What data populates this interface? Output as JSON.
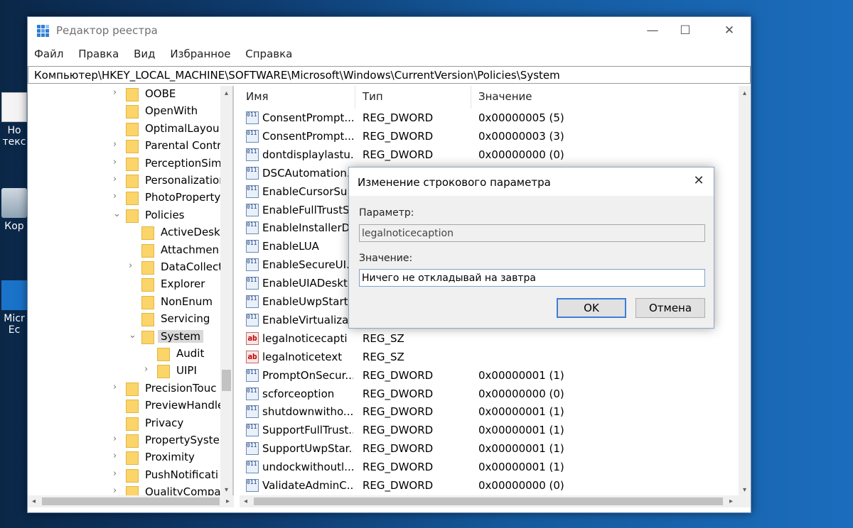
{
  "desktop": {
    "icons": [
      {
        "name": "notepad-icon",
        "label_lines": [
          "Ho",
          "текс"
        ]
      },
      {
        "name": "recycle-bin-icon",
        "label_lines": [
          "Кор"
        ]
      },
      {
        "name": "edge-icon",
        "label_lines": [
          "Micr",
          "Ec"
        ]
      }
    ]
  },
  "window": {
    "title": "Редактор реестра",
    "buttons": {
      "minimize": "—",
      "maximize": "☐",
      "close": "✕"
    },
    "menu": [
      "Файл",
      "Правка",
      "Вид",
      "Избранное",
      "Справка"
    ],
    "address": "Компьютер\\HKEY_LOCAL_MACHINE\\SOFTWARE\\Microsoft\\Windows\\CurrentVersion\\Policies\\System"
  },
  "tree": {
    "items": [
      {
        "label": "OOBE",
        "level": 0,
        "arrow": "›"
      },
      {
        "label": "OpenWith",
        "level": 0,
        "arrow": ""
      },
      {
        "label": "OptimalLayou",
        "level": 0,
        "arrow": ""
      },
      {
        "label": "Parental Contr",
        "level": 0,
        "arrow": "›"
      },
      {
        "label": "PerceptionSim",
        "level": 0,
        "arrow": "›"
      },
      {
        "label": "Personalization",
        "level": 0,
        "arrow": "›"
      },
      {
        "label": "PhotoProperty",
        "level": 0,
        "arrow": "›"
      },
      {
        "label": "Policies",
        "level": 0,
        "arrow": "⌄"
      },
      {
        "label": "ActiveDeskt",
        "level": 1,
        "arrow": ""
      },
      {
        "label": "Attachmen",
        "level": 1,
        "arrow": ""
      },
      {
        "label": "DataCollect",
        "level": 1,
        "arrow": "›"
      },
      {
        "label": "Explorer",
        "level": 1,
        "arrow": ""
      },
      {
        "label": "NonEnum",
        "level": 1,
        "arrow": ""
      },
      {
        "label": "Servicing",
        "level": 1,
        "arrow": ""
      },
      {
        "label": "System",
        "level": 1,
        "arrow": "⌄",
        "selected": true
      },
      {
        "label": "Audit",
        "level": 2,
        "arrow": ""
      },
      {
        "label": "UIPI",
        "level": 2,
        "arrow": "›"
      },
      {
        "label": "PrecisionTouc",
        "level": 0,
        "arrow": "›"
      },
      {
        "label": "PreviewHandle",
        "level": 0,
        "arrow": ""
      },
      {
        "label": "Privacy",
        "level": 0,
        "arrow": ""
      },
      {
        "label": "PropertySyster",
        "level": 0,
        "arrow": "›"
      },
      {
        "label": "Proximity",
        "level": 0,
        "arrow": "›"
      },
      {
        "label": "PushNotificati",
        "level": 0,
        "arrow": "›"
      },
      {
        "label": "QualityCompa",
        "level": 0,
        "arrow": "›"
      }
    ]
  },
  "list": {
    "columns": [
      "Имя",
      "Тип",
      "Значение"
    ],
    "rows": [
      {
        "name": "ConsentPrompt...",
        "type": "REG_DWORD",
        "value": "0x00000005 (5)",
        "kind": "dword"
      },
      {
        "name": "ConsentPrompt...",
        "type": "REG_DWORD",
        "value": "0x00000003 (3)",
        "kind": "dword"
      },
      {
        "name": "dontdisplaylastu...",
        "type": "REG_DWORD",
        "value": "0x00000000 (0)",
        "kind": "dword"
      },
      {
        "name": "DSCAutomation...",
        "type": "",
        "value": "",
        "kind": "dword"
      },
      {
        "name": "EnableCursorSu...",
        "type": "",
        "value": "",
        "kind": "dword"
      },
      {
        "name": "EnableFullTrustS...",
        "type": "",
        "value": "",
        "kind": "dword"
      },
      {
        "name": "EnableInstallerD...",
        "type": "",
        "value": "",
        "kind": "dword"
      },
      {
        "name": "EnableLUA",
        "type": "",
        "value": "",
        "kind": "dword"
      },
      {
        "name": "EnableSecureUI...",
        "type": "",
        "value": "",
        "kind": "dword"
      },
      {
        "name": "EnableUIADeskt...",
        "type": "",
        "value": "",
        "kind": "dword"
      },
      {
        "name": "EnableUwpStart...",
        "type": "",
        "value": "",
        "kind": "dword"
      },
      {
        "name": "EnableVirtualizat",
        "type": "",
        "value": "",
        "kind": "dword"
      },
      {
        "name": "legalnoticecapti",
        "type": "REG_SZ",
        "value": "",
        "kind": "sz"
      },
      {
        "name": "legalnoticetext",
        "type": "REG_SZ",
        "value": "",
        "kind": "sz"
      },
      {
        "name": "PromptOnSecur...",
        "type": "REG_DWORD",
        "value": "0x00000001 (1)",
        "kind": "dword"
      },
      {
        "name": "scforceoption",
        "type": "REG_DWORD",
        "value": "0x00000000 (0)",
        "kind": "dword"
      },
      {
        "name": "shutdownwitho...",
        "type": "REG_DWORD",
        "value": "0x00000001 (1)",
        "kind": "dword"
      },
      {
        "name": "SupportFullTrust...",
        "type": "REG_DWORD",
        "value": "0x00000001 (1)",
        "kind": "dword"
      },
      {
        "name": "SupportUwpStar...",
        "type": "REG_DWORD",
        "value": "0x00000001 (1)",
        "kind": "dword"
      },
      {
        "name": "undockwithoutl...",
        "type": "REG_DWORD",
        "value": "0x00000001 (1)",
        "kind": "dword"
      },
      {
        "name": "ValidateAdminC...",
        "type": "REG_DWORD",
        "value": "0x00000000 (0)",
        "kind": "dword"
      }
    ]
  },
  "dialog": {
    "title": "Изменение строкового параметра",
    "param_label": "Параметр:",
    "param_value": "legalnoticecaption",
    "value_label": "Значение:",
    "value_value": "Ничего не откладывай на завтра",
    "ok": "OK",
    "cancel": "Отмена"
  }
}
